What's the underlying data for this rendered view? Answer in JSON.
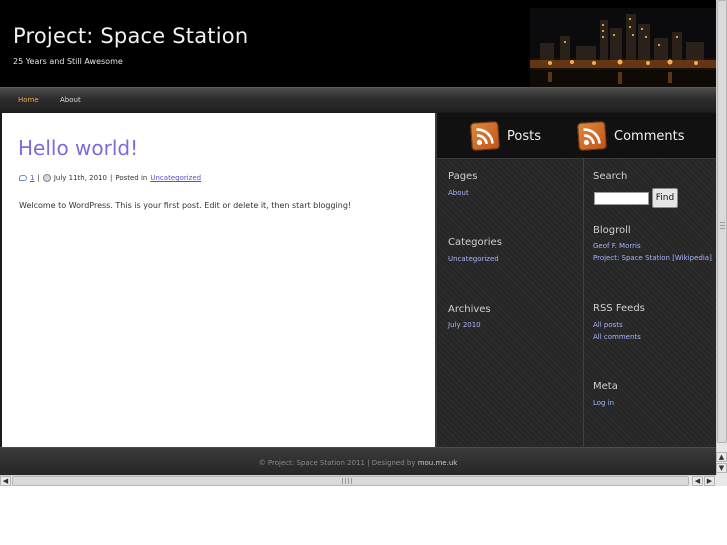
{
  "header": {
    "title": "Project: Space Station",
    "tagline": "25 Years and Still Awesome"
  },
  "nav": {
    "items": [
      {
        "label": "Home",
        "active": true
      },
      {
        "label": "About",
        "active": false
      }
    ]
  },
  "post": {
    "title": "Hello world!",
    "comment_count": "1",
    "separator": "|",
    "date": "July 11th, 2010",
    "posted_in_prefix": "Posted in",
    "category": "Uncategorized",
    "body": "Welcome to WordPress. This is your first post. Edit or delete it, then start blogging!"
  },
  "sidebar": {
    "top": {
      "posts_label": "Posts",
      "comments_label": "Comments",
      "feed_icon": "rss-feed-icon"
    },
    "pages": {
      "title": "Pages",
      "links": [
        "About"
      ]
    },
    "categories": {
      "title": "Categories",
      "links": [
        "Uncategorized"
      ]
    },
    "archives": {
      "title": "Archives",
      "links": [
        "July 2010"
      ]
    },
    "search": {
      "title": "Search",
      "input_value": "",
      "button_label": "Find"
    },
    "blogroll": {
      "title": "Blogroll",
      "links": [
        "Geof F. Morris",
        "Project: Space Station [Wikipedia]"
      ]
    },
    "rss": {
      "title": "RSS Feeds",
      "links": [
        "All posts",
        "All comments"
      ]
    },
    "meta": {
      "title": "Meta",
      "links": [
        "Log in"
      ]
    }
  },
  "footer": {
    "copyright": "© Project: Space Station 2011  |  Designed by",
    "designer_link": "mou.me.uk"
  },
  "colors": {
    "nav_active": "#e8a84c",
    "post_title": "#7b6cd9",
    "sidebar_link": "#a5b4ff",
    "rss_orange": "#d06a2a"
  }
}
